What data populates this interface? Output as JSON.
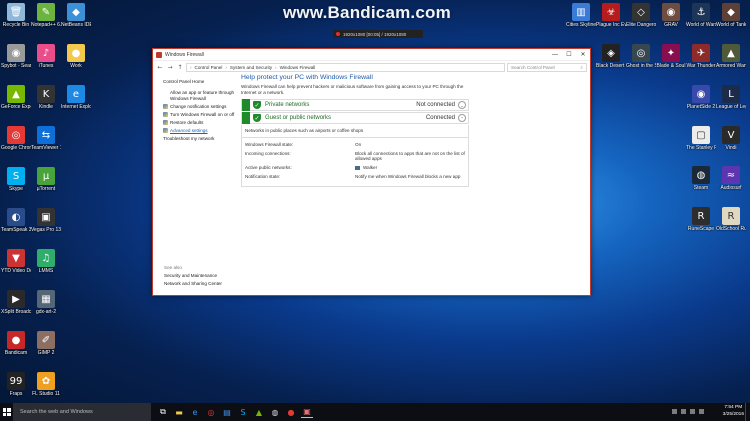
{
  "watermark": "www.Bandicam.com",
  "recorder": {
    "text": "1920x1080 [00:05] / 1920x1080"
  },
  "desktop_icons": [
    {
      "label": "Recycle Bin",
      "color": "#8fb8d8",
      "glyph": "🗑"
    },
    {
      "label": "Notepad++ 6.8.1",
      "color": "#6db33f",
      "glyph": "✎"
    },
    {
      "label": "NetBeans IDE 8.1",
      "color": "#3d8fd6",
      "glyph": "◆"
    },
    {
      "label": "Spybot - Search ...",
      "color": "#9a9a9a",
      "glyph": "◉"
    },
    {
      "label": "iTunes",
      "color": "#e94e8a",
      "glyph": "♪"
    },
    {
      "label": "Work",
      "color": "#f2c94c",
      "glyph": "●"
    },
    {
      "label": "GeForce Experience",
      "color": "#76b900",
      "glyph": "▲"
    },
    {
      "label": "Kindle",
      "color": "#333333",
      "glyph": "K"
    },
    {
      "label": "Internet Explorer",
      "color": "#1e88e5",
      "glyph": "e"
    },
    {
      "label": "Google Chrome",
      "color": "#e53935",
      "glyph": "◎"
    },
    {
      "label": "TeamViewer 11",
      "color": "#0e6fd9",
      "glyph": "⇆"
    },
    {
      "label": "Skype",
      "color": "#00aff0",
      "glyph": "S"
    },
    {
      "label": "µTorrent",
      "color": "#49a33b",
      "glyph": "µ"
    },
    {
      "label": "TeamSpeak 3 Client",
      "color": "#2a4c8a",
      "glyph": "◐"
    },
    {
      "label": "Vegas Pro 13.0 (64-bit)",
      "color": "#333333",
      "glyph": "▣"
    },
    {
      "label": "YTD Video Downloader",
      "color": "#cc3333",
      "glyph": "▼"
    },
    {
      "label": "LMMS",
      "color": "#2fae6b",
      "glyph": "♫"
    },
    {
      "label": "XSplit Broadcaster",
      "color": "#2a2a2a",
      "glyph": "▶"
    },
    {
      "label": "gdx-art-2",
      "color": "#556677",
      "glyph": "▦"
    },
    {
      "label": "Bandicam",
      "color": "#c62828",
      "glyph": "●"
    },
    {
      "label": "GIMP 2",
      "color": "#8d6e63",
      "glyph": "✐"
    },
    {
      "label": "Fraps",
      "color": "#222222",
      "glyph": "99"
    },
    {
      "label": "FL Studio 11",
      "color": "#f0a020",
      "glyph": "✿"
    }
  ],
  "right_icons": [
    {
      "label": "Cities Skylines",
      "color": "#3a7bd5",
      "glyph": "▥"
    },
    {
      "label": "Plague Inc Evolved",
      "color": "#b71c1c",
      "glyph": "☣"
    },
    {
      "label": "Elite Dangerous",
      "color": "#333333",
      "glyph": "◇"
    },
    {
      "label": "GRAV",
      "color": "#6d4c41",
      "glyph": "◉"
    },
    {
      "label": "World of Warships",
      "color": "#1d3557",
      "glyph": "⚓"
    },
    {
      "label": "World of Tanks",
      "color": "#5d4037",
      "glyph": "◆"
    },
    {
      "label": "Black Desert Online",
      "color": "#222222",
      "glyph": "◈"
    },
    {
      "label": "Ghost in the Shell Stand ...",
      "color": "#37474f",
      "glyph": "◎"
    },
    {
      "label": "Blade & Soul",
      "color": "#880e4f",
      "glyph": "✦"
    },
    {
      "label": "War Thunder",
      "color": "#8d2a2a",
      "glyph": "✈"
    },
    {
      "label": "Armored Warfare",
      "color": "#4e5a3a",
      "glyph": "▲"
    },
    {
      "label": "PlanetSide 2",
      "color": "#3949ab",
      "glyph": "◉"
    },
    {
      "label": "League of Legends",
      "color": "#1c2b4a",
      "glyph": "L"
    },
    {
      "label": "The Stanley Parable",
      "color": "#ececec",
      "glyph": "▢"
    },
    {
      "label": "Vindi",
      "color": "#2a2a2a",
      "glyph": "V"
    },
    {
      "label": "Steam",
      "color": "#1b2838",
      "glyph": "◍"
    },
    {
      "label": "Audiosurf",
      "color": "#5e35b1",
      "glyph": "≈"
    },
    {
      "label": "RuneScape",
      "color": "#2d2d2d",
      "glyph": "R"
    },
    {
      "label": "OldSchool RuneScape",
      "color": "#e0d8c0",
      "glyph": "R"
    }
  ],
  "window": {
    "title": "Windows Firewall",
    "min": "—",
    "max": "☐",
    "close": "✕",
    "back": "←",
    "forward": "→",
    "up": "↑",
    "crumbs": [
      "Control Panel",
      "System and Security",
      "Windows Firewall"
    ],
    "search_placeholder": "Search Control Panel",
    "left": {
      "home": "Control Panel Home",
      "links": [
        {
          "text": "Allow an app or feature through Windows Firewall",
          "shield": false
        },
        {
          "text": "Change notification settings",
          "shield": true
        },
        {
          "text": "Turn Windows Firewall on or off",
          "shield": true
        },
        {
          "text": "Restore defaults",
          "shield": true
        },
        {
          "text": "Advanced settings",
          "shield": true
        },
        {
          "text": "Troubleshoot my network",
          "shield": false
        }
      ],
      "see_also_header": "See also",
      "see_also": [
        "Security and Maintenance",
        "Network and Sharing Center"
      ]
    },
    "main": {
      "heading": "Help protect your PC with Windows Firewall",
      "description": "Windows Firewall can help prevent hackers or malicious software from gaining access to your PC through the Internet or a network.",
      "private": {
        "name": "Private networks",
        "status": "Not connected"
      },
      "public": {
        "name": "Guest or public networks",
        "status": "Connected"
      },
      "network_info": "Networks in public places such as airports or coffee shops",
      "state_label": "Windows Firewall state:",
      "state_value": "On",
      "incoming_label": "Incoming connections:",
      "incoming_value": "Block all connections to apps that are not on the list of allowed apps",
      "active_label": "Active public networks:",
      "active_value": "Walker",
      "notify_label": "Notification state:",
      "notify_value": "Notify me when Windows Firewall blocks a new app"
    }
  },
  "taskbar": {
    "search_placeholder": "Search the web and Windows",
    "time": "7:54 PM",
    "date": "3/25/2016"
  }
}
